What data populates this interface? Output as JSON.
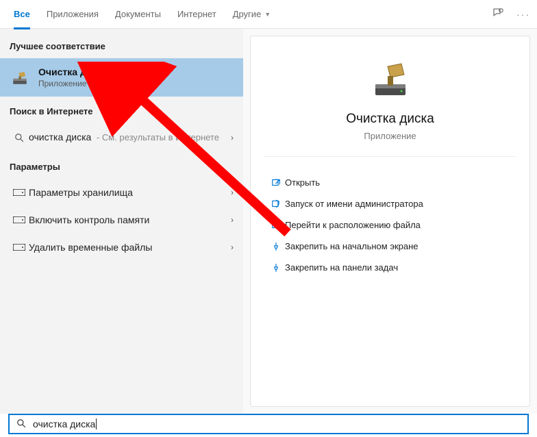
{
  "tabs": {
    "items": [
      "Все",
      "Приложения",
      "Документы",
      "Интернет",
      "Другие"
    ],
    "activeIndex": 0
  },
  "left": {
    "bestMatchHeader": "Лучшее соответствие",
    "bestMatch": {
      "title": "Очистка диска",
      "sub": "Приложение"
    },
    "webHeader": "Поиск в Интернете",
    "webItem": {
      "label": "очистка диска",
      "suffix": " - См. результаты в Интернете"
    },
    "paramsHeader": "Параметры",
    "params": [
      "Параметры хранилища",
      "Включить контроль памяти",
      "Удалить временные файлы"
    ]
  },
  "right": {
    "title": "Очистка диска",
    "sub": "Приложение",
    "actions": [
      "Открыть",
      "Запуск от имени администратора",
      "Перейти к расположению файла",
      "Закрепить на начальном экране",
      "Закрепить на панели задач"
    ]
  },
  "search": {
    "query": "очистка диска"
  }
}
